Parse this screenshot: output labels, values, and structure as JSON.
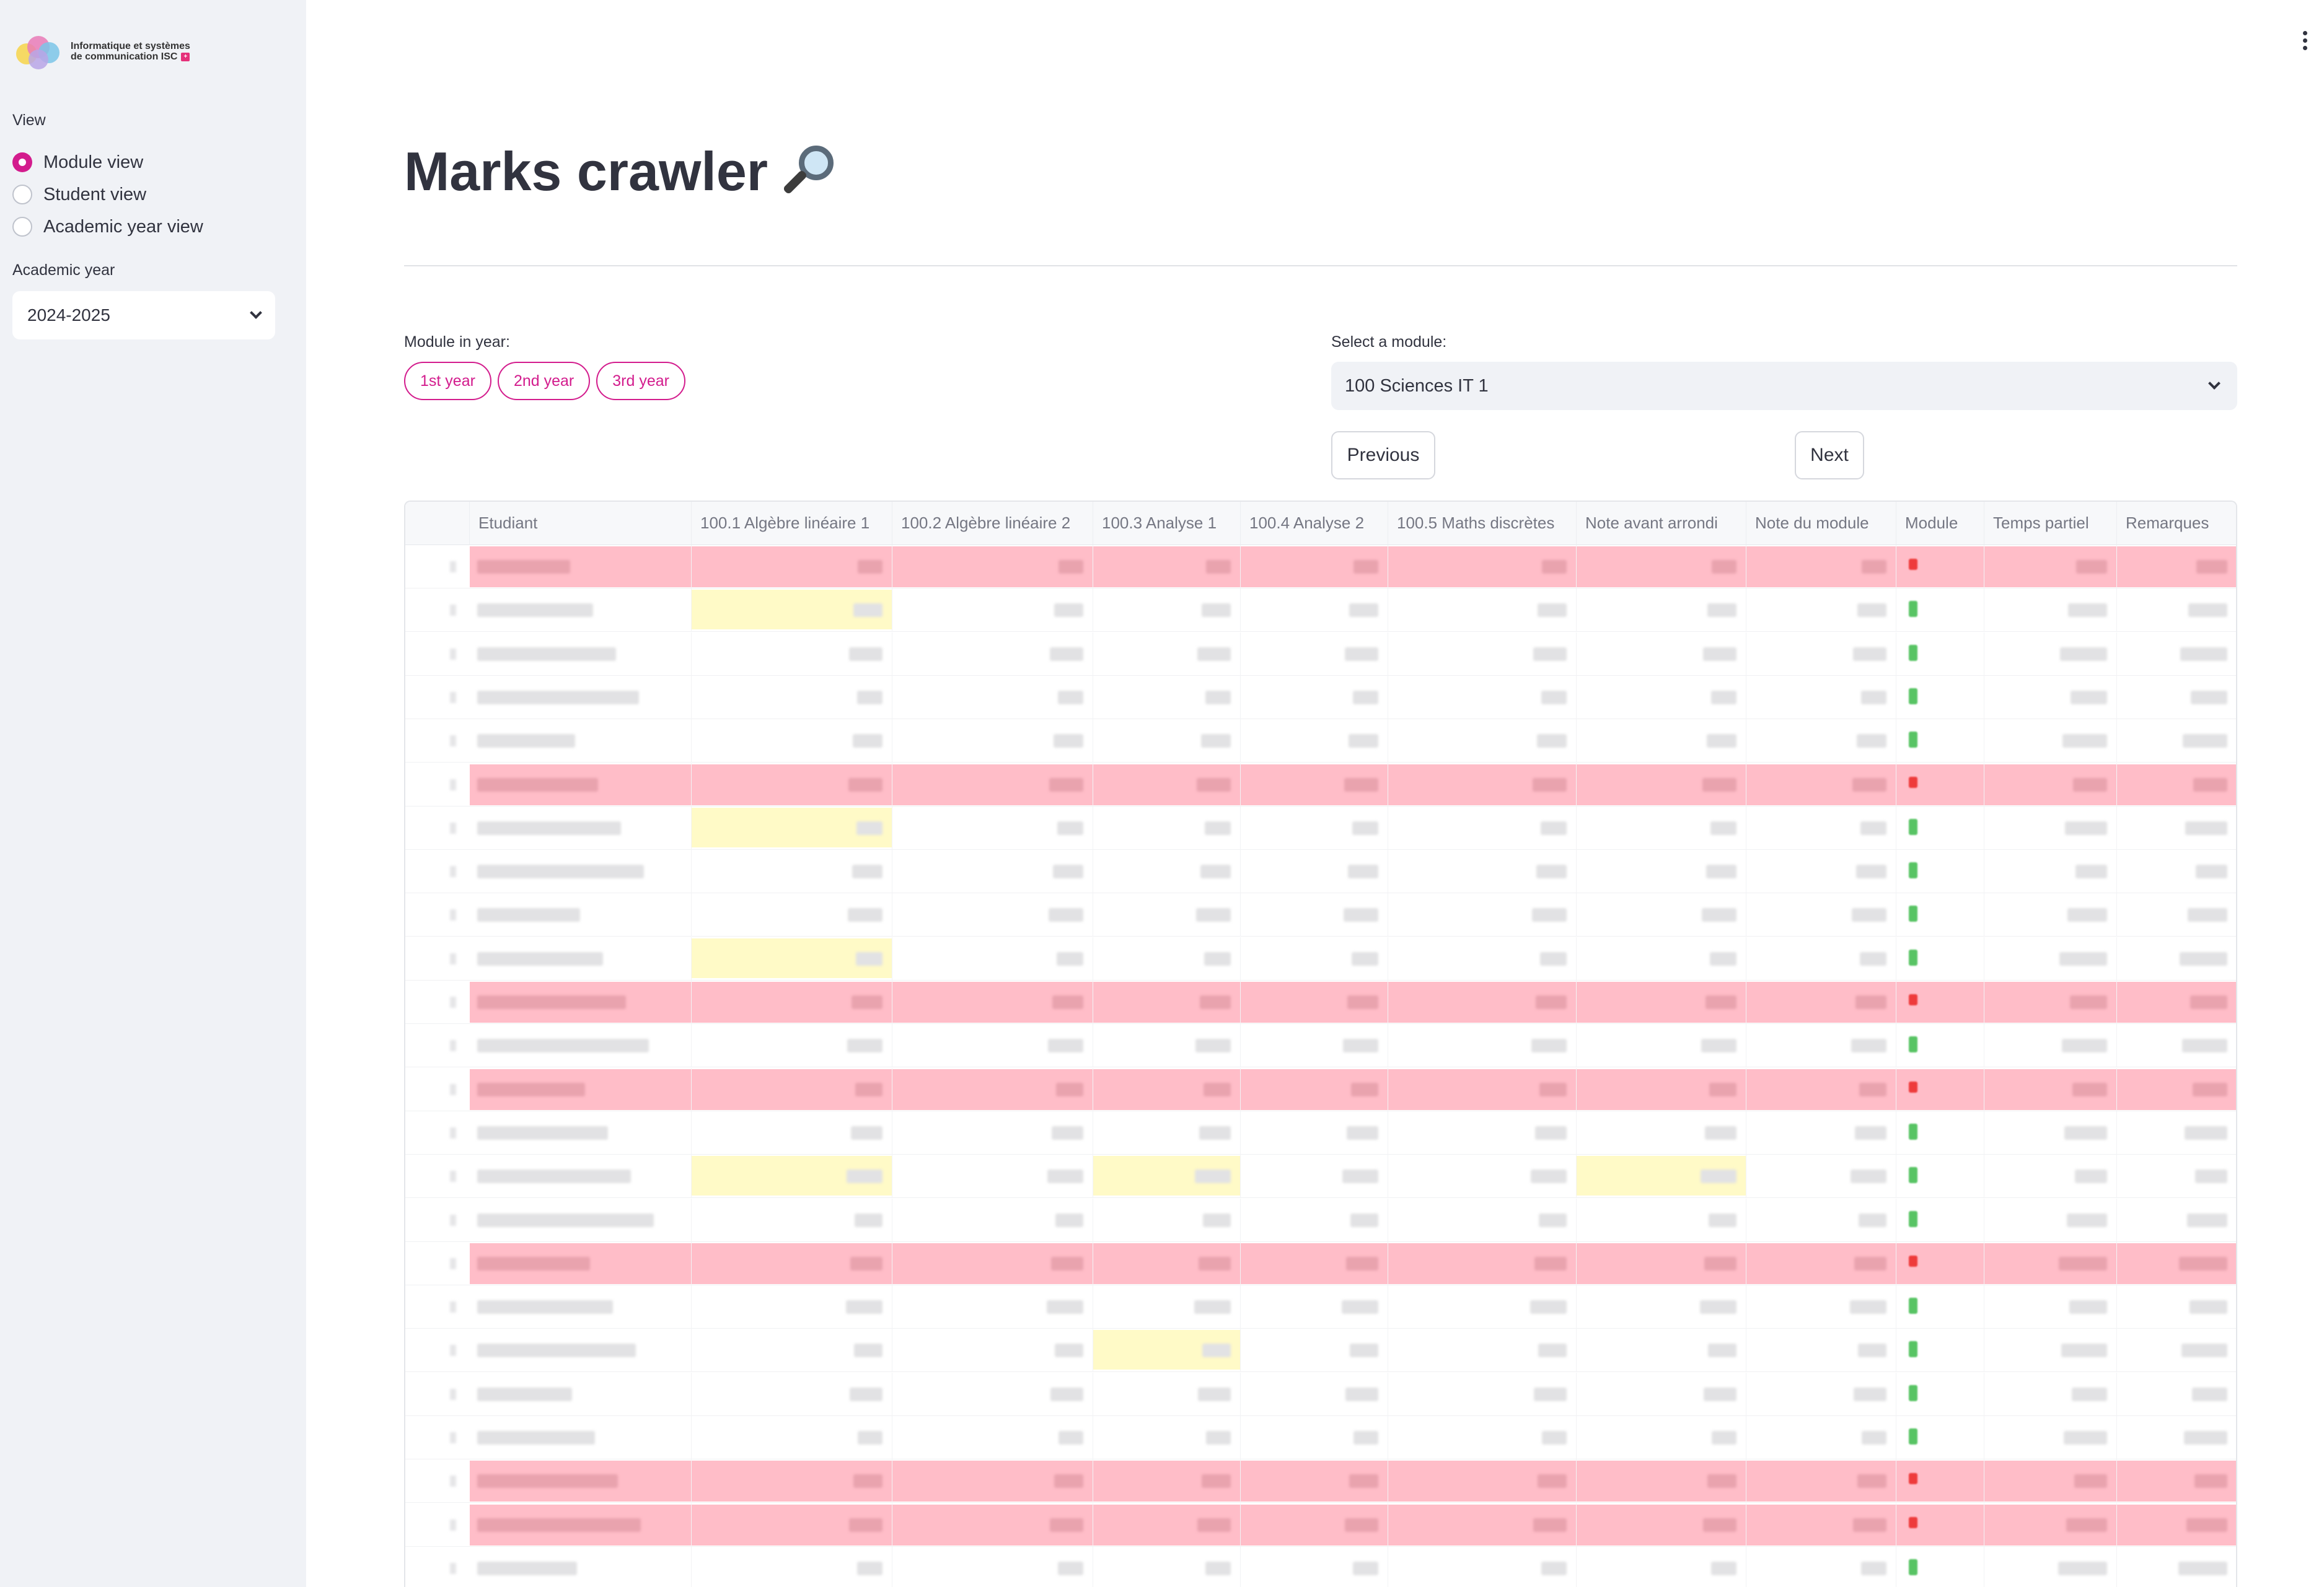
{
  "sidebar": {
    "logo": {
      "line1": "Informatique et systèmes",
      "line2": "de communication ISC"
    },
    "view_label": "View",
    "view_options": [
      "Module view",
      "Student view",
      "Academic year view"
    ],
    "view_selected": 0,
    "academic_year_label": "Academic year",
    "academic_year_value": "2024-2025"
  },
  "main": {
    "title": "Marks crawler",
    "module_in_year_label": "Module in year:",
    "year_buttons": [
      "1st year",
      "2nd year",
      "3rd year"
    ],
    "select_module_label": "Select a module:",
    "selected_module": "100 Sciences IT 1",
    "previous_label": "Previous",
    "next_label": "Next"
  },
  "colors": {
    "accent": "#d31c8d",
    "failed_row": "#ffbdc8",
    "highlight_cell": "#fffac7",
    "pass_marker": "#58c464",
    "fail_marker": "#ee3b3b"
  },
  "table": {
    "columns": [
      "Etudiant",
      "100.1 Algèbre linéaire 1",
      "100.2 Algèbre linéaire 2",
      "100.3 Analyse 1",
      "100.4 Analyse 2",
      "100.5 Maths discrètes",
      "Note avant arrondi",
      "Note du module",
      "Module",
      "Temps partiel",
      "Remarques"
    ],
    "rows": [
      {
        "failed": true,
        "highlight": []
      },
      {
        "failed": false,
        "highlight": [
          1
        ]
      },
      {
        "failed": false,
        "highlight": []
      },
      {
        "failed": false,
        "highlight": []
      },
      {
        "failed": false,
        "highlight": []
      },
      {
        "failed": true,
        "highlight": []
      },
      {
        "failed": false,
        "highlight": [
          1
        ]
      },
      {
        "failed": false,
        "highlight": []
      },
      {
        "failed": false,
        "highlight": []
      },
      {
        "failed": false,
        "highlight": [
          1
        ]
      },
      {
        "failed": true,
        "highlight": []
      },
      {
        "failed": false,
        "highlight": []
      },
      {
        "failed": true,
        "highlight": []
      },
      {
        "failed": false,
        "highlight": []
      },
      {
        "failed": false,
        "highlight": [
          1,
          3,
          6
        ]
      },
      {
        "failed": false,
        "highlight": []
      },
      {
        "failed": true,
        "highlight": []
      },
      {
        "failed": false,
        "highlight": []
      },
      {
        "failed": false,
        "highlight": [
          3
        ]
      },
      {
        "failed": false,
        "highlight": []
      },
      {
        "failed": false,
        "highlight": []
      },
      {
        "failed": true,
        "highlight": []
      },
      {
        "failed": true,
        "highlight": []
      },
      {
        "failed": false,
        "highlight": []
      }
    ]
  }
}
